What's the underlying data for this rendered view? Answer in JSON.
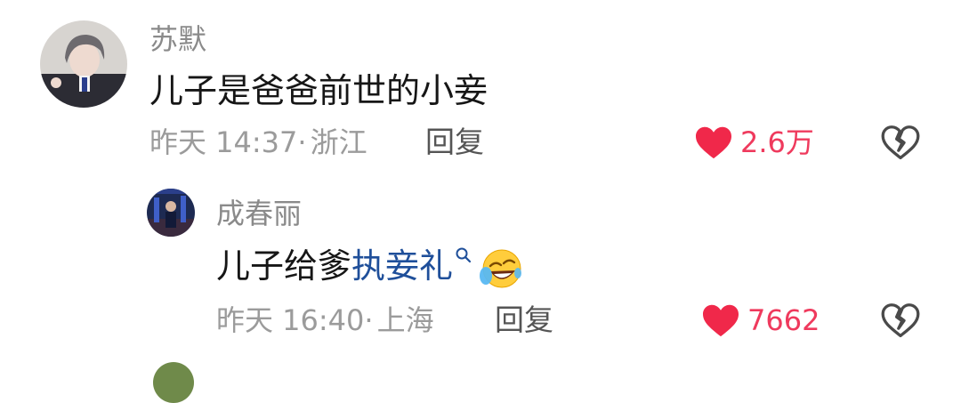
{
  "comments": [
    {
      "username": "苏默",
      "text": "儿子是爸爸前世的小妾",
      "time": "昨天 14:37",
      "separator": "·",
      "location": "浙江",
      "reply_label": "回复",
      "likes": "2.6万",
      "replies": [
        {
          "username": "成春丽",
          "text_prefix": "儿子给爹",
          "link_text": "执妾礼",
          "time": "昨天 16:40",
          "separator": "·",
          "location": "上海",
          "reply_label": "回复",
          "likes": "7662"
        }
      ]
    }
  ],
  "colors": {
    "like_heart": "#f0284a",
    "like_count": "#ef3a5d",
    "link": "#1f4f9a",
    "username": "#8a8a8a",
    "meta": "#9b9b9b"
  },
  "icons": {
    "like": "heart-icon",
    "dislike": "broken-heart-icon",
    "search": "search-icon",
    "emoji": "laughing-crying-emoji"
  }
}
